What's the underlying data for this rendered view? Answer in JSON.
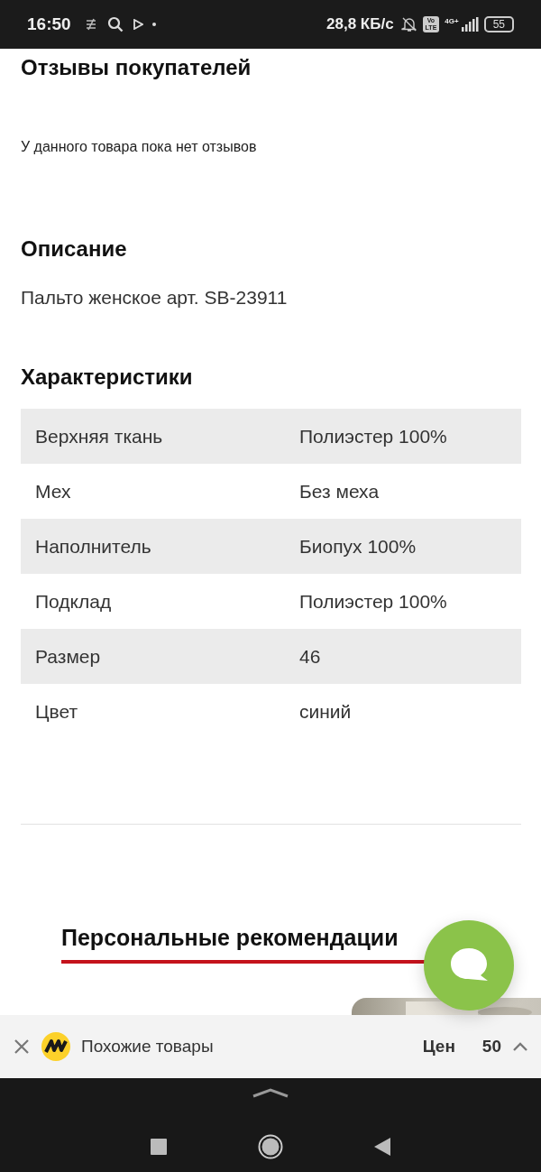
{
  "status_bar": {
    "time": "16:50",
    "speed": "28,8 КБ/с",
    "volte": [
      "Vo",
      "LTE"
    ],
    "network": "4G+",
    "battery": "55"
  },
  "reviews": {
    "title": "Отзывы покупателей",
    "empty_text": "У данного товара пока нет отзывов"
  },
  "description": {
    "title": "Описание",
    "text": "Пальто женское арт. SB-23911"
  },
  "specs": {
    "title": "Характеристики",
    "rows": [
      {
        "name": "Верхняя ткань",
        "value": "Полиэстер 100%"
      },
      {
        "name": "Мех",
        "value": "Без меха"
      },
      {
        "name": "Наполнитель",
        "value": "Биопух 100%"
      },
      {
        "name": "Подклад",
        "value": "Полиэстер 100%"
      },
      {
        "name": "Размер",
        "value": "46"
      },
      {
        "name": "Цвет",
        "value": "синий"
      }
    ]
  },
  "recommendations": {
    "title": "Персональные рекомендации"
  },
  "similar_bar": {
    "label": "Похожие товары",
    "price_parts": [
      "Цен",
      "50"
    ]
  }
}
